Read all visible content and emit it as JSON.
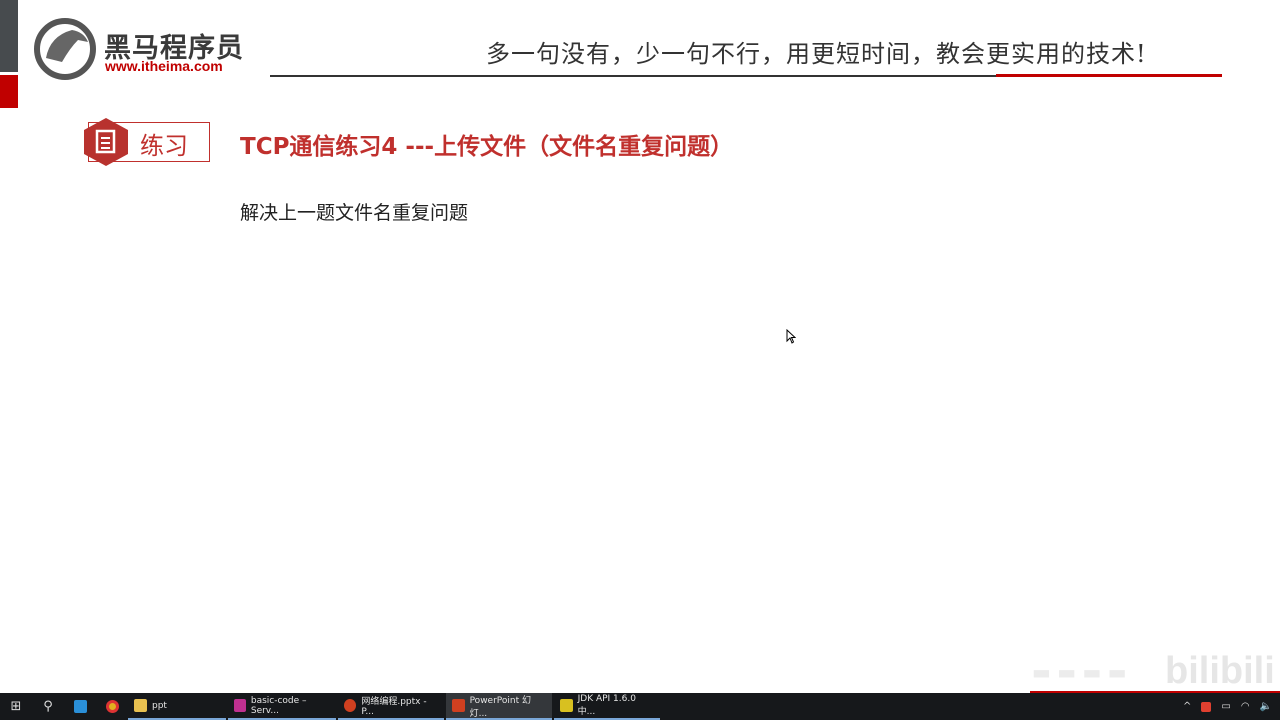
{
  "header": {
    "brand": "黑马程序员",
    "url": "www.itheima.com",
    "slogan": "多一句没有，少一句不行，用更短时间，教会更实用的技术!"
  },
  "slide": {
    "tag": "练习",
    "title": "TCP通信练习4 ---上传文件（文件名重复问题）",
    "body": "解决上一题文件名重复问题"
  },
  "watermark": {
    "text": "bilibili"
  },
  "colors": {
    "accent": "#c0302d",
    "taskbar": "#16181b"
  },
  "taskbar": {
    "items": [
      {
        "label": "ppt",
        "icon": "folder-icon"
      },
      {
        "label": "basic-code – Serv...",
        "icon": "intellij-icon"
      },
      {
        "label": "网络编程.pptx - P...",
        "icon": "powerpoint-icon"
      },
      {
        "label": "PowerPoint 幻灯...",
        "icon": "powerpoint-slideshow-icon",
        "active": true
      },
      {
        "label": "JDK API 1.6.0 中...",
        "icon": "help-file-icon"
      }
    ]
  }
}
